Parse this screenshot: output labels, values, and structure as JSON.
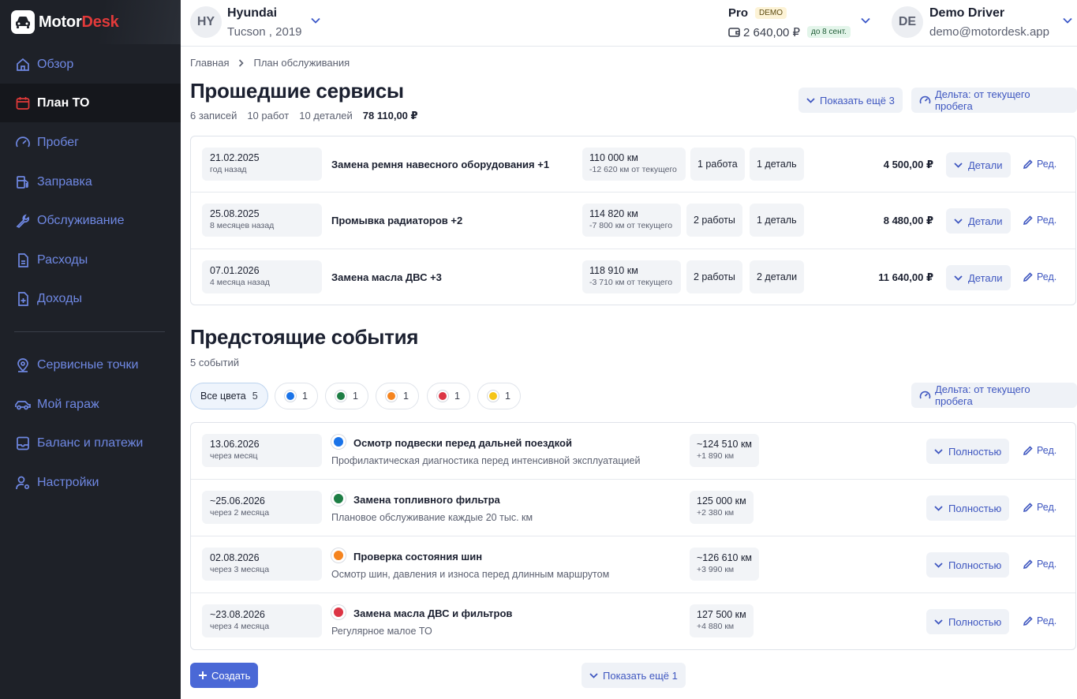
{
  "brand": {
    "name_part1": "Motor",
    "name_part2": "Desk"
  },
  "sidebar": {
    "items": [
      {
        "label": "Обзор",
        "icon": "home-icon",
        "active": false
      },
      {
        "label": "План ТО",
        "icon": "calendar-icon",
        "active": true
      },
      {
        "label": "Пробег",
        "icon": "speedometer-icon",
        "active": false
      },
      {
        "label": "Заправка",
        "icon": "fuel-icon",
        "active": false
      },
      {
        "label": "Обслуживание",
        "icon": "wrench-icon",
        "active": false
      },
      {
        "label": "Расходы",
        "icon": "document-icon",
        "active": false
      },
      {
        "label": "Доходы",
        "icon": "document-plus-icon",
        "active": false
      },
      {
        "label": "Сервисные точки",
        "icon": "map-pin-icon",
        "active": false
      },
      {
        "label": "Мой гараж",
        "icon": "car-icon",
        "active": false
      },
      {
        "label": "Баланс и платежи",
        "icon": "receipt-icon",
        "active": false
      },
      {
        "label": "Настройки",
        "icon": "user-gear-icon",
        "active": false
      }
    ]
  },
  "topbar": {
    "car": {
      "initials": "HY",
      "make": "Hyundai",
      "model": "Tucson , 2019"
    },
    "plan": {
      "name": "Pro",
      "badge": "DEMO",
      "balance": "2 640,00 ₽",
      "until": "до 8 сент."
    },
    "user": {
      "initials": "DE",
      "name": "Demo Driver",
      "email": "demo@motordesk.app"
    }
  },
  "breadcrumb": {
    "home": "Главная",
    "current": "План обслуживания"
  },
  "past": {
    "title": "Прошедшие сервисы",
    "stats": {
      "records": "6 записей",
      "works": "10 работ",
      "parts": "10 деталей",
      "total": "78 110,00 ₽"
    },
    "show_more": "Показать ещё 3",
    "delta": "Дельта: от текущего пробега",
    "details_label": "Детали",
    "edit_label": "Ред.",
    "rows": [
      {
        "date": "21.02.2025",
        "rel": "год назад",
        "title": "Замена ремня навесного оборудования +1",
        "km": "110 000 км",
        "km_delta": "-12 620 км от текущего",
        "works": "1 работа",
        "parts": "1 деталь",
        "price": "4 500,00 ₽"
      },
      {
        "date": "25.08.2025",
        "rel": "8 месяцев назад",
        "title": "Промывка радиаторов +2",
        "km": "114 820 км",
        "km_delta": "-7 800 км от текущего",
        "works": "2 работы",
        "parts": "1 деталь",
        "price": "8 480,00 ₽"
      },
      {
        "date": "07.01.2026",
        "rel": "4 месяца назад",
        "title": "Замена масла ДВС +3",
        "km": "118 910 км",
        "km_delta": "-3 710 км от текущего",
        "works": "2 работы",
        "parts": "2 детали",
        "price": "11 640,00 ₽"
      }
    ]
  },
  "upcoming": {
    "title": "Предстоящие события",
    "count": "5 событий",
    "delta": "Дельта: от текущего пробега",
    "full_label": "Полностью",
    "edit_label": "Ред.",
    "filters": {
      "all": {
        "label": "Все цвета",
        "count": "5"
      },
      "colors": [
        {
          "color": "#1a73e8",
          "count": "1"
        },
        {
          "color": "#1e7e45",
          "count": "1"
        },
        {
          "color": "#f5841f",
          "count": "1"
        },
        {
          "color": "#dc3545",
          "count": "1"
        },
        {
          "color": "#f5c518",
          "count": "1"
        }
      ]
    },
    "rows": [
      {
        "date": "13.06.2026",
        "rel": "через месяц",
        "color": "#1a73e8",
        "title": "Осмотр подвески перед дальней поездкой",
        "desc": "Профилактическая диагностика перед интенсивной эксплуатацией",
        "km": "~124 510 км",
        "km_delta": "+1 890 км"
      },
      {
        "date": "~25.06.2026",
        "rel": "через 2 месяца",
        "color": "#1e7e45",
        "title": "Замена топливного фильтра",
        "desc": "Плановое обслуживание каждые 20 тыс. км",
        "km": "125 000 км",
        "km_delta": "+2 380 км"
      },
      {
        "date": "02.08.2026",
        "rel": "через 3 месяца",
        "color": "#f5841f",
        "title": "Проверка состояния шин",
        "desc": "Осмотр шин, давления и износа перед длинным маршрутом",
        "km": "~126 610 км",
        "km_delta": "+3 990 км"
      },
      {
        "date": "~23.08.2026",
        "rel": "через 4 месяца",
        "color": "#dc3545",
        "title": "Замена масла ДВС и фильтров",
        "desc": "Регулярное малое ТО",
        "km": "127 500 км",
        "km_delta": "+4 880 км"
      }
    ],
    "create": "Создать",
    "show_more": "Показать ещё 1"
  },
  "colors": {
    "accent": "#3f57c0",
    "primary": "#4a68d6",
    "sidebar_bg": "#1e2128",
    "brand_red": "#e23a3a"
  }
}
